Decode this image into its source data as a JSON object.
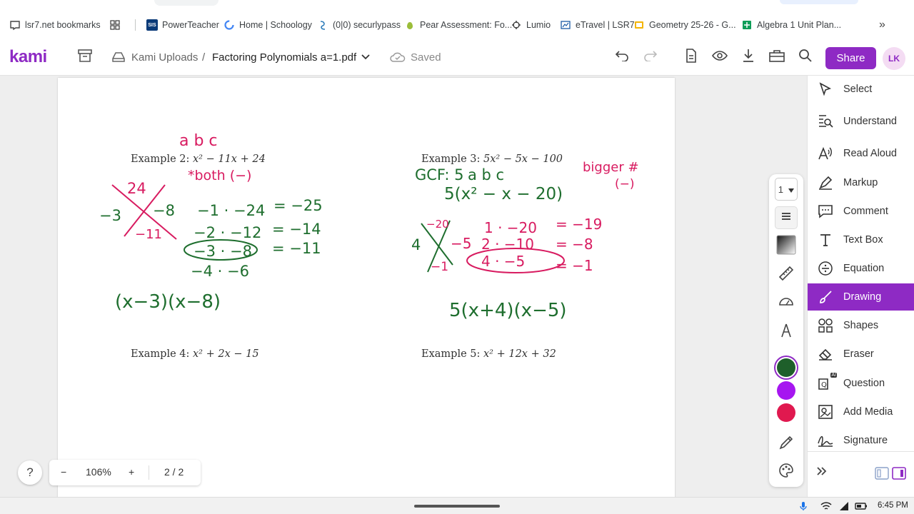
{
  "bookmarks": [
    {
      "label": "lsr7.net bookmarks",
      "icon": "bookmark-folder-icon"
    },
    {
      "label": "PowerTeacher",
      "icon": "sis-icon"
    },
    {
      "label": "Home | Schoology",
      "icon": "google-icon"
    },
    {
      "label": "(0|0) securlypass",
      "icon": "securly-icon"
    },
    {
      "label": "Pear Assessment: Fo...",
      "icon": "pear-icon"
    },
    {
      "label": "Lumio",
      "icon": "lumio-icon"
    },
    {
      "label": "eTravel | LSR7",
      "icon": "etravel-icon"
    },
    {
      "label": "Geometry 25-26 - G...",
      "icon": "slides-icon"
    },
    {
      "label": "Algebra 1 Unit Plan...",
      "icon": "sheets-icon"
    }
  ],
  "sis_badge": "SIS",
  "more_glyph": "»",
  "header": {
    "logo": "kami",
    "folder": "Kami Uploads",
    "separator": "/",
    "filename": "Factoring Polynomials a=1.pdf",
    "status": "Saved",
    "share_label": "Share",
    "avatar": "LK"
  },
  "worksheet": {
    "ex2": {
      "prefix": "Example 2: ",
      "expr": "x² − 11x + 24"
    },
    "ex3": {
      "prefix": "Example 3: ",
      "expr": "5x² − 5x − 100"
    },
    "ex4": {
      "prefix": "Example 4: ",
      "expr": "x² + 2x − 15"
    },
    "ex5": {
      "prefix": "Example 5: ",
      "expr": "x² + 12x + 32"
    }
  },
  "handwriting": {
    "ex2": {
      "abc": "a   b   c",
      "note": "*both (−)",
      "x_top": "24",
      "x_left": "−3",
      "x_right": "−8",
      "x_bottom": "−11",
      "pairs": [
        "−1 · −24",
        "−2 · −12",
        "−3 · −8",
        "−4 · −6"
      ],
      "sums": [
        "= −25",
        "= −14",
        "= −11"
      ],
      "answer": "(x−3)(x−8)"
    },
    "ex3": {
      "gcf": "GCF: 5",
      "abc": "a   b   c",
      "factored": "5(x² − x − 20)",
      "note1": "bigger #",
      "note2": "(−)",
      "x_top": "−20",
      "x_left": "4",
      "x_right": "−5",
      "x_bottom": "−1",
      "pairs": [
        "1 · −20",
        "2 · −10",
        "4 · −5"
      ],
      "sums": [
        "= −19",
        "= −8",
        "= −1"
      ],
      "answer": "5(x+4)(x−5)"
    }
  },
  "tools": [
    {
      "label": "Select",
      "icon": "cursor-icon",
      "active": false
    },
    {
      "label": "Understand",
      "icon": "understand-icon",
      "active": false
    },
    {
      "label": "Read Aloud",
      "icon": "read-aloud-icon",
      "active": false
    },
    {
      "label": "Markup",
      "icon": "markup-icon",
      "active": false
    },
    {
      "label": "Comment",
      "icon": "comment-icon",
      "active": false
    },
    {
      "label": "Text Box",
      "icon": "text-box-icon",
      "active": false
    },
    {
      "label": "Equation",
      "icon": "equation-icon",
      "active": false
    },
    {
      "label": "Drawing",
      "icon": "brush-icon",
      "active": true
    },
    {
      "label": "Shapes",
      "icon": "shapes-icon",
      "active": false
    },
    {
      "label": "Eraser",
      "icon": "eraser-icon",
      "active": false
    },
    {
      "label": "Question",
      "icon": "question-ai-icon",
      "active": false
    },
    {
      "label": "Add Media",
      "icon": "add-media-icon",
      "active": false
    },
    {
      "label": "Signature",
      "icon": "signature-icon",
      "active": false
    }
  ],
  "ai_badge": "AI",
  "palette": {
    "size": "1",
    "colors": [
      "#1e5f2a",
      "#a616f0",
      "#e0194f"
    ],
    "selected_color": "#1e5f2a"
  },
  "zoom": {
    "minus": "−",
    "level": "106%",
    "plus": "+",
    "page": "2 / 2",
    "help": "?"
  },
  "shelf": {
    "time": "6:45 PM"
  },
  "colors": {
    "accent": "#8e2ac4",
    "ink_green": "#1e6e2e",
    "ink_pink": "#d81b60"
  }
}
